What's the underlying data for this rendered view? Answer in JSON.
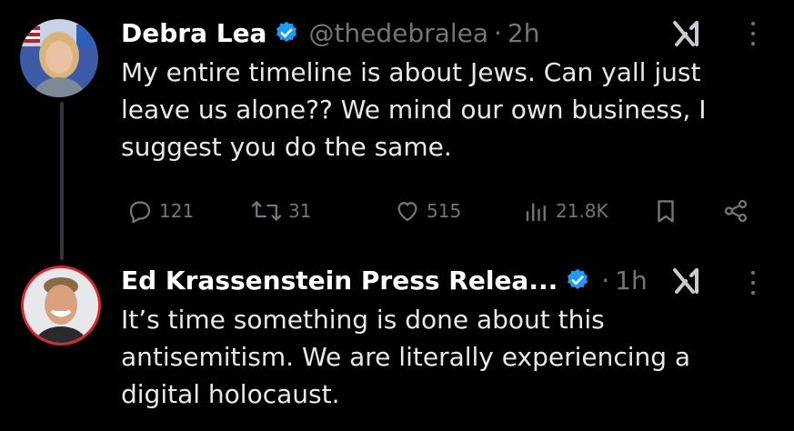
{
  "tweets": [
    {
      "display_name": "Debra Lea",
      "handle": "@thedebralea",
      "separator": "·",
      "time": "2h",
      "text": "My entire timeline is about Jews. Can yall just leave us alone?? We mind our own business, I suggest you do the same.",
      "metrics": {
        "replies": "121",
        "reposts": "31",
        "likes": "515",
        "views": "21.8K"
      }
    },
    {
      "display_name": "Ed Krassenstein Press Relea...",
      "separator": "·",
      "time": "1h",
      "text": "It’s time something is done about this antisemitism. We are literally experiencing a digital holocaust."
    }
  ],
  "icons": {
    "verified": "verified-badge-icon",
    "grok": "grok-icon",
    "more": "more-options-icon",
    "reply": "reply-icon",
    "repost": "repost-icon",
    "like": "like-icon",
    "views": "views-icon",
    "bookmark": "bookmark-icon",
    "share": "share-icon"
  },
  "colors": {
    "background": "#000000",
    "text": "#e7e9ea",
    "secondary": "#71767b",
    "verified": "#1d9bf0",
    "avatar_ring": "#d8262d"
  }
}
